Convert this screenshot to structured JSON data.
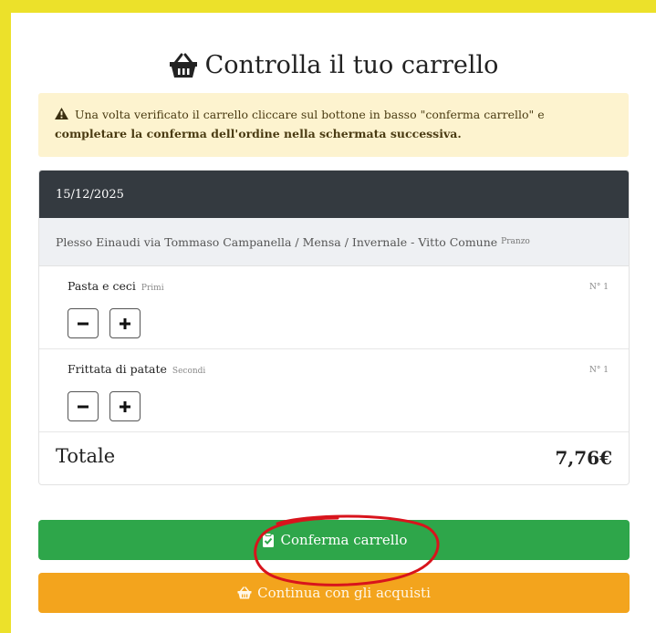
{
  "page": {
    "title": "Controlla il tuo carrello"
  },
  "alert": {
    "text_part1": " Una volta verificato il carrello cliccare sul bottone in basso \"conferma carrello\" e ",
    "text_bold": "completare la conferma dell'ordine nella schermata successiva."
  },
  "cart": {
    "date": "15/12/2025",
    "location": "Plesso Einaudi via Tommaso Campanella / Mensa / Invernale - Vitto Comune",
    "meal": "Pranzo",
    "items": [
      {
        "name": "Pasta e ceci",
        "category": "Primi",
        "qty": "N° 1"
      },
      {
        "name": "Frittata di patate",
        "category": "Secondi",
        "qty": "N° 1"
      }
    ],
    "total_label": "Totale",
    "total_value": "7,76€"
  },
  "buttons": {
    "confirm_label": "Conferma carrello",
    "continue_label": "Continua con gli acquisti"
  },
  "colors": {
    "background": "#ece12a",
    "confirm": "#2ea64a",
    "continue": "#f3a41d",
    "header_dark": "#343a40",
    "alert_bg": "#fdf3cf",
    "annotation": "#d8141c"
  },
  "icons": [
    "basket-icon",
    "warning-icon",
    "minus-icon",
    "plus-icon",
    "clipboard-check-icon"
  ]
}
